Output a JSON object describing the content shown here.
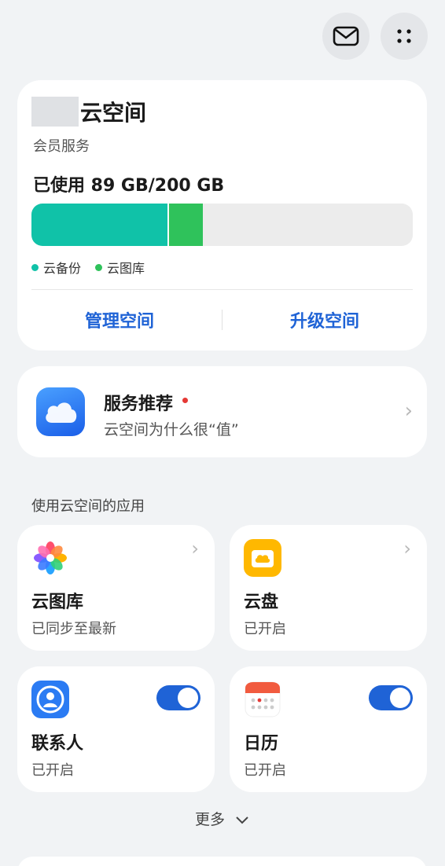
{
  "header": {
    "mail_icon": "mail-icon",
    "menu_icon": "more-grid-icon"
  },
  "storage": {
    "title": "云空间",
    "member_label": "会员服务",
    "usage_text": "已使用 89 GB/200 GB",
    "used_gb": 89,
    "total_gb": 200,
    "backup_fraction": 0.36,
    "gallery_fraction": 0.09,
    "legend": [
      {
        "label": "云备份",
        "color": "#10c2a8"
      },
      {
        "label": "云图库",
        "color": "#2fc25b"
      }
    ],
    "manage_label": "管理空间",
    "upgrade_label": "升级空间"
  },
  "recommend": {
    "title": "服务推荐",
    "subtitle": "云空间为什么很“值”"
  },
  "apps_section_title": "使用云空间的应用",
  "apps": [
    {
      "name": "云图库",
      "status": "已同步至最新",
      "icon": "gallery-icon"
    },
    {
      "name": "云盘",
      "status": "已开启",
      "icon": "cloud-drive-icon"
    },
    {
      "name": "联系人",
      "status": "已开启",
      "icon": "contacts-icon",
      "enabled": true
    },
    {
      "name": "日历",
      "status": "已开启",
      "icon": "calendar-icon",
      "enabled": true
    }
  ],
  "more_label": "更多"
}
